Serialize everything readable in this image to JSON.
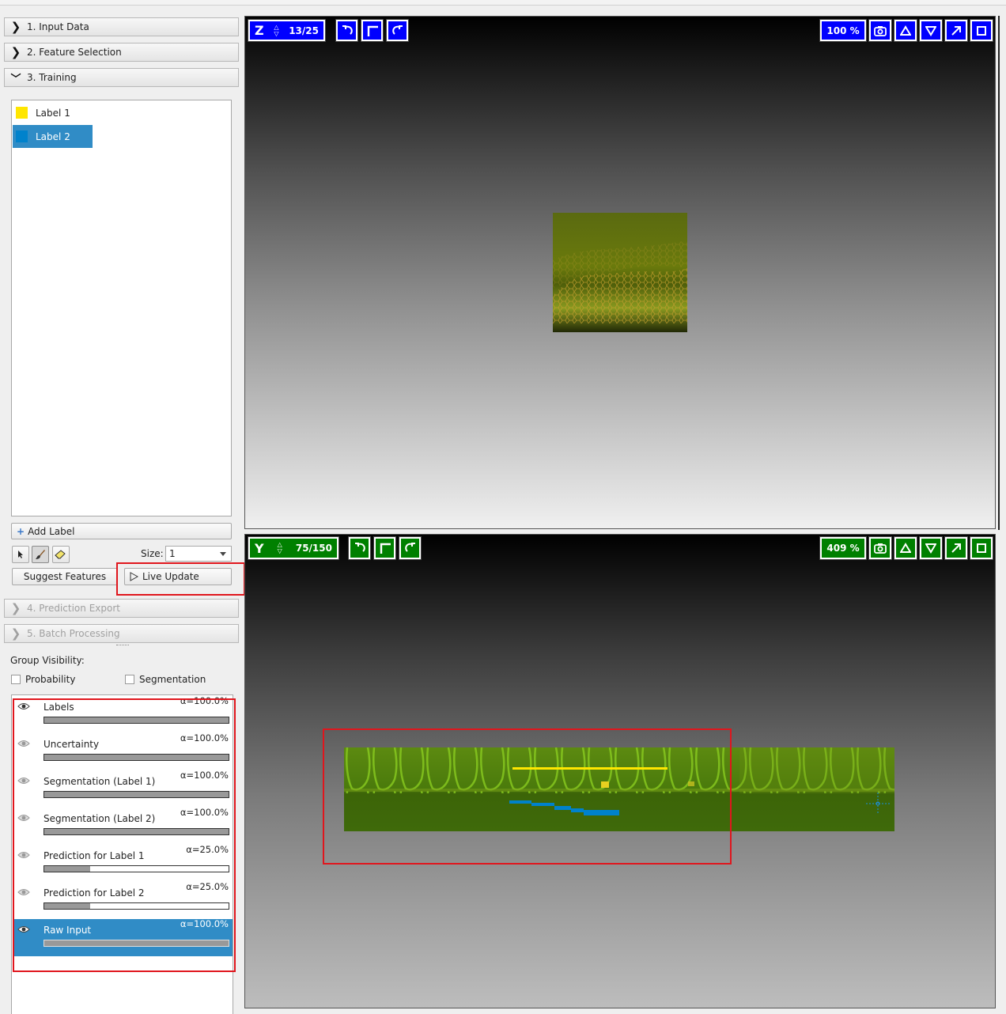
{
  "applets": [
    {
      "label": "1. Input Data",
      "expanded": false,
      "enabled": true
    },
    {
      "label": "2. Feature Selection",
      "expanded": false,
      "enabled": true
    },
    {
      "label": "3. Training",
      "expanded": true,
      "enabled": true
    },
    {
      "label": "4. Prediction Export",
      "expanded": false,
      "enabled": false
    },
    {
      "label": "5. Batch Processing",
      "expanded": false,
      "enabled": false
    }
  ],
  "labels": [
    {
      "name": "Label 1",
      "color": "#ffe600",
      "selected": false
    },
    {
      "name": "Label 2",
      "color": "#0082cc",
      "selected": true
    }
  ],
  "training": {
    "add_label": "Add Label",
    "size_label": "Size:",
    "size_value": "1",
    "suggest_features": "Suggest Features",
    "live_update": "Live Update"
  },
  "group_visibility": {
    "title": "Group Visibility:",
    "probability": "Probability",
    "segmentation": "Segmentation"
  },
  "layers": [
    {
      "name": "Labels",
      "alpha": "α=100.0%",
      "opacity": 1.0,
      "visible": true,
      "selected": false
    },
    {
      "name": "Uncertainty",
      "alpha": "α=100.0%",
      "opacity": 1.0,
      "visible": false,
      "selected": false
    },
    {
      "name": "Segmentation (Label 1)",
      "alpha": "α=100.0%",
      "opacity": 1.0,
      "visible": false,
      "selected": false
    },
    {
      "name": "Segmentation (Label 2)",
      "alpha": "α=100.0%",
      "opacity": 1.0,
      "visible": false,
      "selected": false
    },
    {
      "name": "Prediction for Label 1",
      "alpha": "α=25.0%",
      "opacity": 0.25,
      "visible": false,
      "selected": false
    },
    {
      "name": "Prediction for Label 2",
      "alpha": "α=25.0%",
      "opacity": 0.25,
      "visible": false,
      "selected": false
    },
    {
      "name": "Raw Input",
      "alpha": "α=100.0%",
      "opacity": 1.0,
      "visible": true,
      "selected": true
    }
  ],
  "views": {
    "top": {
      "axis": "Z",
      "slice": "13/25",
      "zoom": "100 %",
      "color": "#0000ff"
    },
    "bottom": {
      "axis": "Y",
      "slice": "75/150",
      "zoom": "409 %",
      "color": "#008000"
    }
  }
}
